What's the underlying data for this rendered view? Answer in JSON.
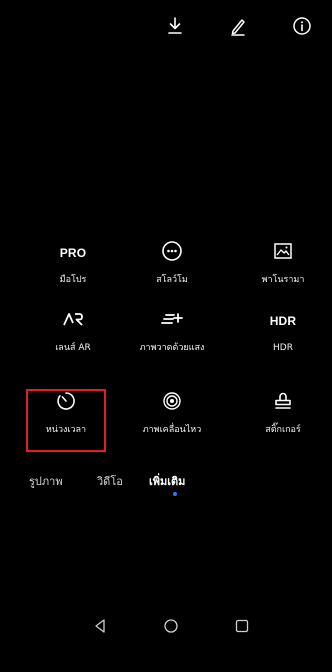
{
  "toolbar": {
    "download": "download-icon",
    "edit": "edit-icon",
    "info": "info-icon"
  },
  "modes": [
    {
      "icon": "PRO",
      "label": "มือโปร"
    },
    {
      "icon": "slow-motion-icon",
      "label": "สโลว์โม"
    },
    {
      "icon": "panorama-icon",
      "label": "พาโนรามา"
    },
    {
      "icon": "AR-lens-icon",
      "label": "เลนส์ AR"
    },
    {
      "icon": "light-painting-icon",
      "label": "ภาพวาดด้วยแสง"
    },
    {
      "icon": "HDR",
      "label": "HDR"
    },
    {
      "icon": "timer-icon",
      "label": "หน่วงเวลา"
    },
    {
      "icon": "moving-picture-icon",
      "label": "ภาพเคลื่อนไหว"
    },
    {
      "icon": "sticker-icon",
      "label": "สติ๊กเกอร์"
    }
  ],
  "highlighted_mode": "หน่วงเวลา",
  "tabs": [
    {
      "label": "รูปภาพ"
    },
    {
      "label": "วิดีโอ"
    },
    {
      "label": "เพิ่มเติม",
      "active": true
    }
  ],
  "colors": {
    "background": "#000000",
    "highlight_border": "#e0201f",
    "active_indicator": "#2f7bff"
  },
  "navbar": {
    "back": "back-triangle-icon",
    "home": "home-circle-icon",
    "recents": "recents-square-icon"
  }
}
